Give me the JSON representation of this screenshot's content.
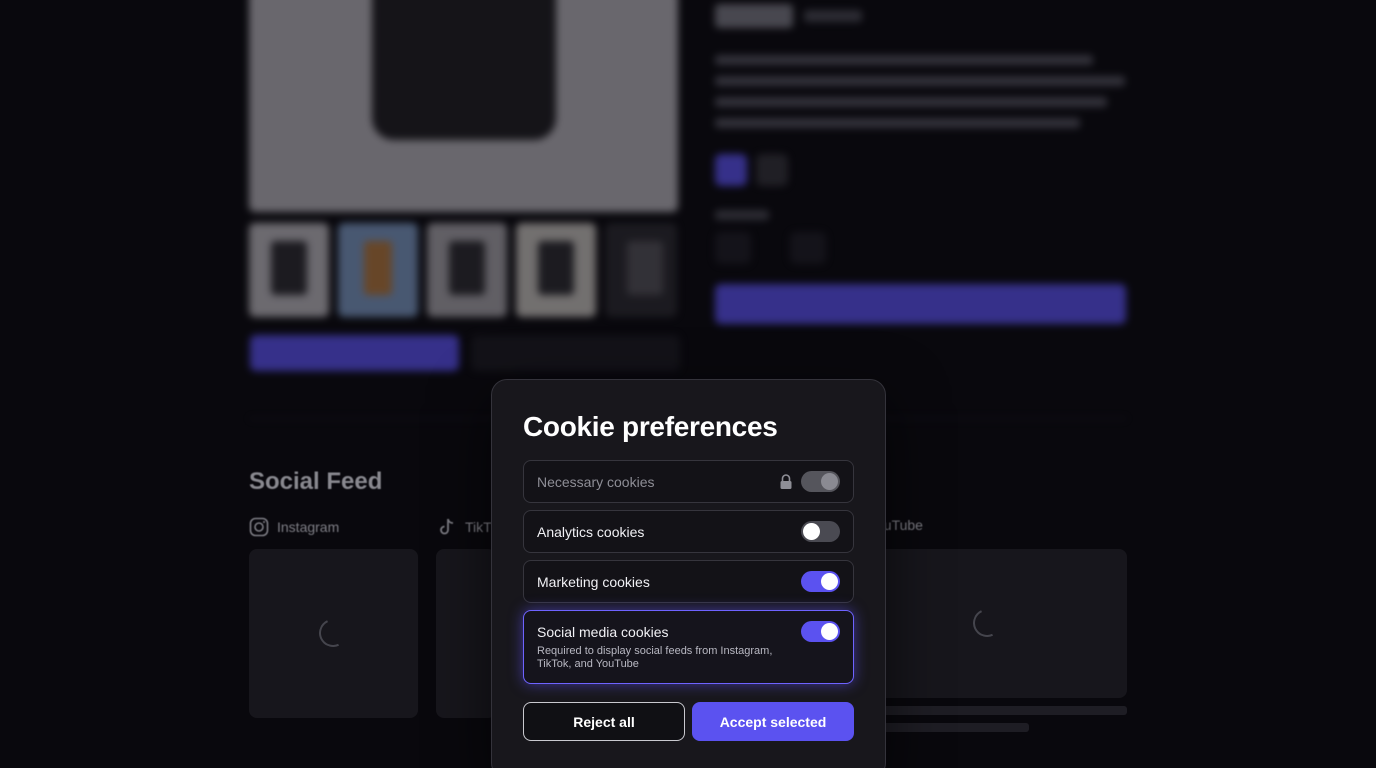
{
  "modal": {
    "title": "Cookie preferences",
    "options": [
      {
        "label": "Necessary cookies",
        "state": "locked"
      },
      {
        "label": "Analytics cookies",
        "state": "off"
      },
      {
        "label": "Marketing cookies",
        "state": "on"
      },
      {
        "label": "Social media cookies",
        "state": "on",
        "description": "Required to display social feeds from Instagram, TikTok, and YouTube"
      }
    ],
    "reject_label": "Reject all",
    "accept_label": "Accept selected"
  },
  "social_feed": {
    "title": "Social Feed",
    "columns": [
      {
        "label": "Instagram",
        "icon": "instagram-icon"
      },
      {
        "label": "TikT",
        "icon": "tiktok-icon"
      },
      {
        "label": "ouTube",
        "icon": "youtube-icon"
      }
    ]
  },
  "colors": {
    "accent": "#5b52f0",
    "background": "#09080d",
    "modal": "#18171c"
  }
}
